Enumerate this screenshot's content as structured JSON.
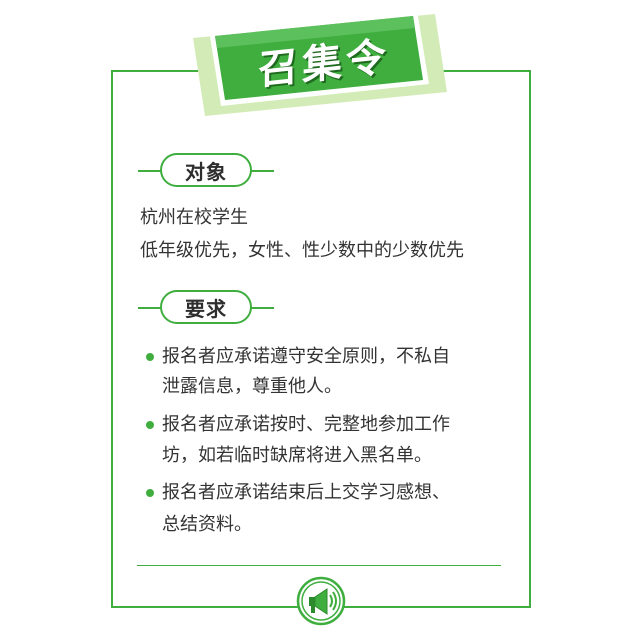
{
  "title": "召集令",
  "sections": {
    "target": {
      "heading": "对象",
      "lines": [
        "杭州在校学生",
        "低年级优先，女性、性少数中的少数优先"
      ]
    },
    "requirements": {
      "heading": "要求",
      "items": [
        {
          "line1": "报名者应承诺遵守安全原则，不私自",
          "line2": "泄露信息，尊重他人。"
        },
        {
          "line1": "报名者应承诺按时、完整地参加工作",
          "line2": "坊，如若临时缺席将进入黑名单。"
        },
        {
          "line1": "报名者应承诺结束后上交学习感想、",
          "line2": "总结资料。"
        }
      ]
    }
  },
  "colors": {
    "accent": "#3fae3f",
    "accent_dark": "#2b8a2b",
    "accent_light": "#d3ecb7"
  },
  "icons": {
    "footer": "megaphone-icon"
  }
}
